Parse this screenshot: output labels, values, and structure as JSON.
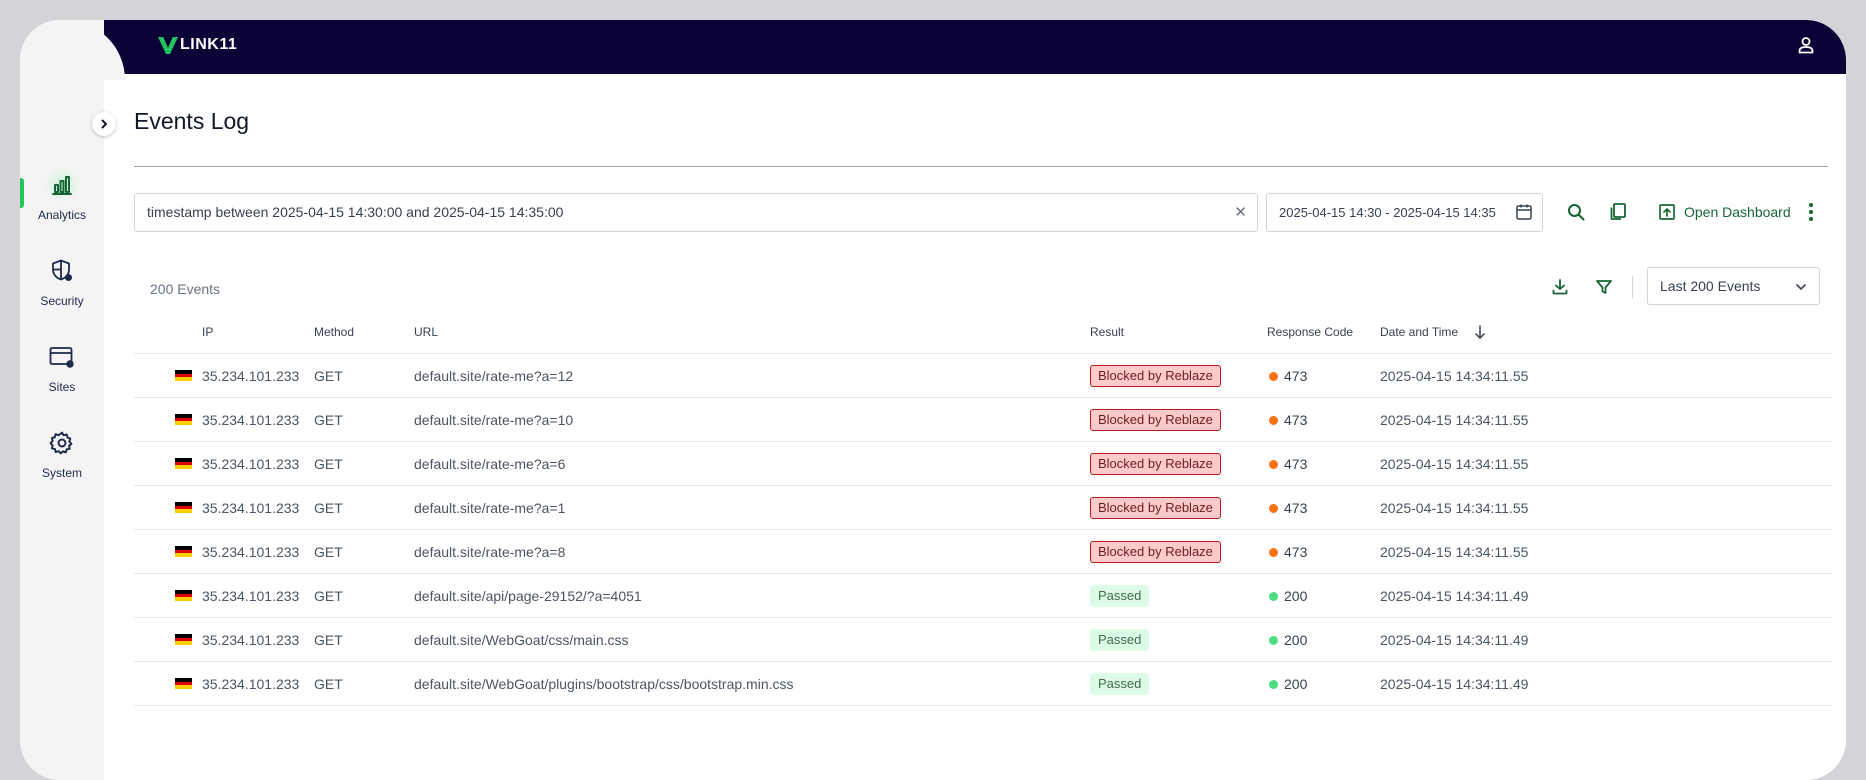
{
  "app": {
    "logo_text": "LINK11"
  },
  "sidebar": {
    "items": [
      {
        "label": "Analytics",
        "icon": "bar-chart-icon",
        "active": true
      },
      {
        "label": "Security",
        "icon": "shield-gear-icon",
        "active": false
      },
      {
        "label": "Sites",
        "icon": "browser-gear-icon",
        "active": false
      },
      {
        "label": "System",
        "icon": "gear-icon",
        "active": false
      }
    ]
  },
  "page": {
    "title": "Events Log"
  },
  "query": {
    "value": "timestamp between 2025-04-15 14:30:00 and 2025-04-15 14:35:00",
    "clear_icon": "close-icon"
  },
  "date_range": {
    "value": "2025-04-15 14:30 - 2025-04-15 14:35"
  },
  "toolbar": {
    "open_dashboard_label": "Open Dashboard"
  },
  "events": {
    "count_label": "200 Events",
    "limit_select": "Last 200 Events"
  },
  "table": {
    "columns": [
      "IP",
      "Method",
      "URL",
      "Result",
      "Response Code",
      "Date and Time"
    ],
    "rows": [
      {
        "ip": "35.234.101.233",
        "method": "GET",
        "url": "default.site/rate-me?a=12",
        "result": "Blocked by Reblaze",
        "status": "blocked",
        "code": "473",
        "datetime": "2025-04-15 14:34:11.55"
      },
      {
        "ip": "35.234.101.233",
        "method": "GET",
        "url": "default.site/rate-me?a=10",
        "result": "Blocked by Reblaze",
        "status": "blocked",
        "code": "473",
        "datetime": "2025-04-15 14:34:11.55"
      },
      {
        "ip": "35.234.101.233",
        "method": "GET",
        "url": "default.site/rate-me?a=6",
        "result": "Blocked by Reblaze",
        "status": "blocked",
        "code": "473",
        "datetime": "2025-04-15 14:34:11.55"
      },
      {
        "ip": "35.234.101.233",
        "method": "GET",
        "url": "default.site/rate-me?a=1",
        "result": "Blocked by Reblaze",
        "status": "blocked",
        "code": "473",
        "datetime": "2025-04-15 14:34:11.55"
      },
      {
        "ip": "35.234.101.233",
        "method": "GET",
        "url": "default.site/rate-me?a=8",
        "result": "Blocked by Reblaze",
        "status": "blocked",
        "code": "473",
        "datetime": "2025-04-15 14:34:11.55"
      },
      {
        "ip": "35.234.101.233",
        "method": "GET",
        "url": "default.site/api/page-29152/?a=4051",
        "result": "Passed",
        "status": "passed",
        "code": "200",
        "datetime": "2025-04-15 14:34:11.49"
      },
      {
        "ip": "35.234.101.233",
        "method": "GET",
        "url": "default.site/WebGoat/css/main.css",
        "result": "Passed",
        "status": "passed",
        "code": "200",
        "datetime": "2025-04-15 14:34:11.49"
      },
      {
        "ip": "35.234.101.233",
        "method": "GET",
        "url": "default.site/WebGoat/plugins/bootstrap/css/bootstrap.min.css",
        "result": "Passed",
        "status": "passed",
        "code": "200",
        "datetime": "2025-04-15 14:34:11.49"
      }
    ]
  },
  "colors": {
    "topbar": "#0b0235",
    "accent_green": "#166534",
    "active_indicator": "#22c55e",
    "blocked_dot": "#f97316",
    "passed_dot": "#4ade80",
    "flag_de": [
      "#000000",
      "#dd0000",
      "#ffce00"
    ]
  }
}
